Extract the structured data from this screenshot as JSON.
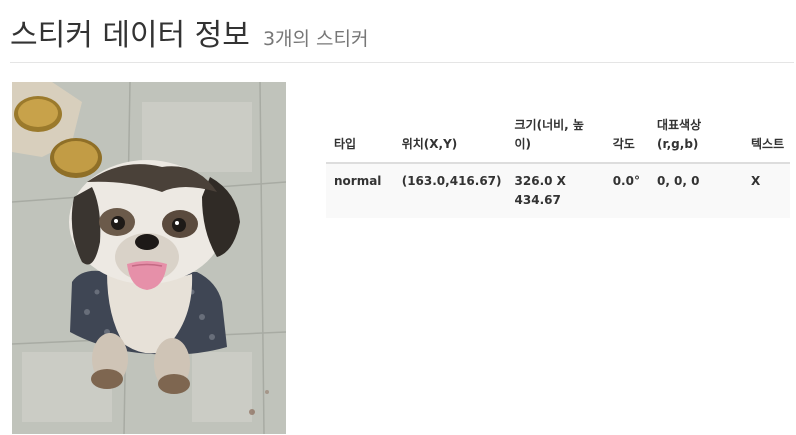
{
  "header": {
    "title": "스티커 데이터 정보",
    "subtitle": "3개의 스티커"
  },
  "photo": {
    "icon": "dog-photo"
  },
  "table": {
    "columns": [
      "타입",
      "위치(X,Y)",
      "크기(너비, 높이)",
      "각도",
      "대표색상(r,g,b)",
      "텍스트"
    ],
    "rows": [
      {
        "type": "normal",
        "position": "(163.0,416.67)",
        "size": "326.0 X 434.67",
        "angle": "0.0°",
        "color": "0, 0, 0",
        "text": "X"
      }
    ]
  }
}
